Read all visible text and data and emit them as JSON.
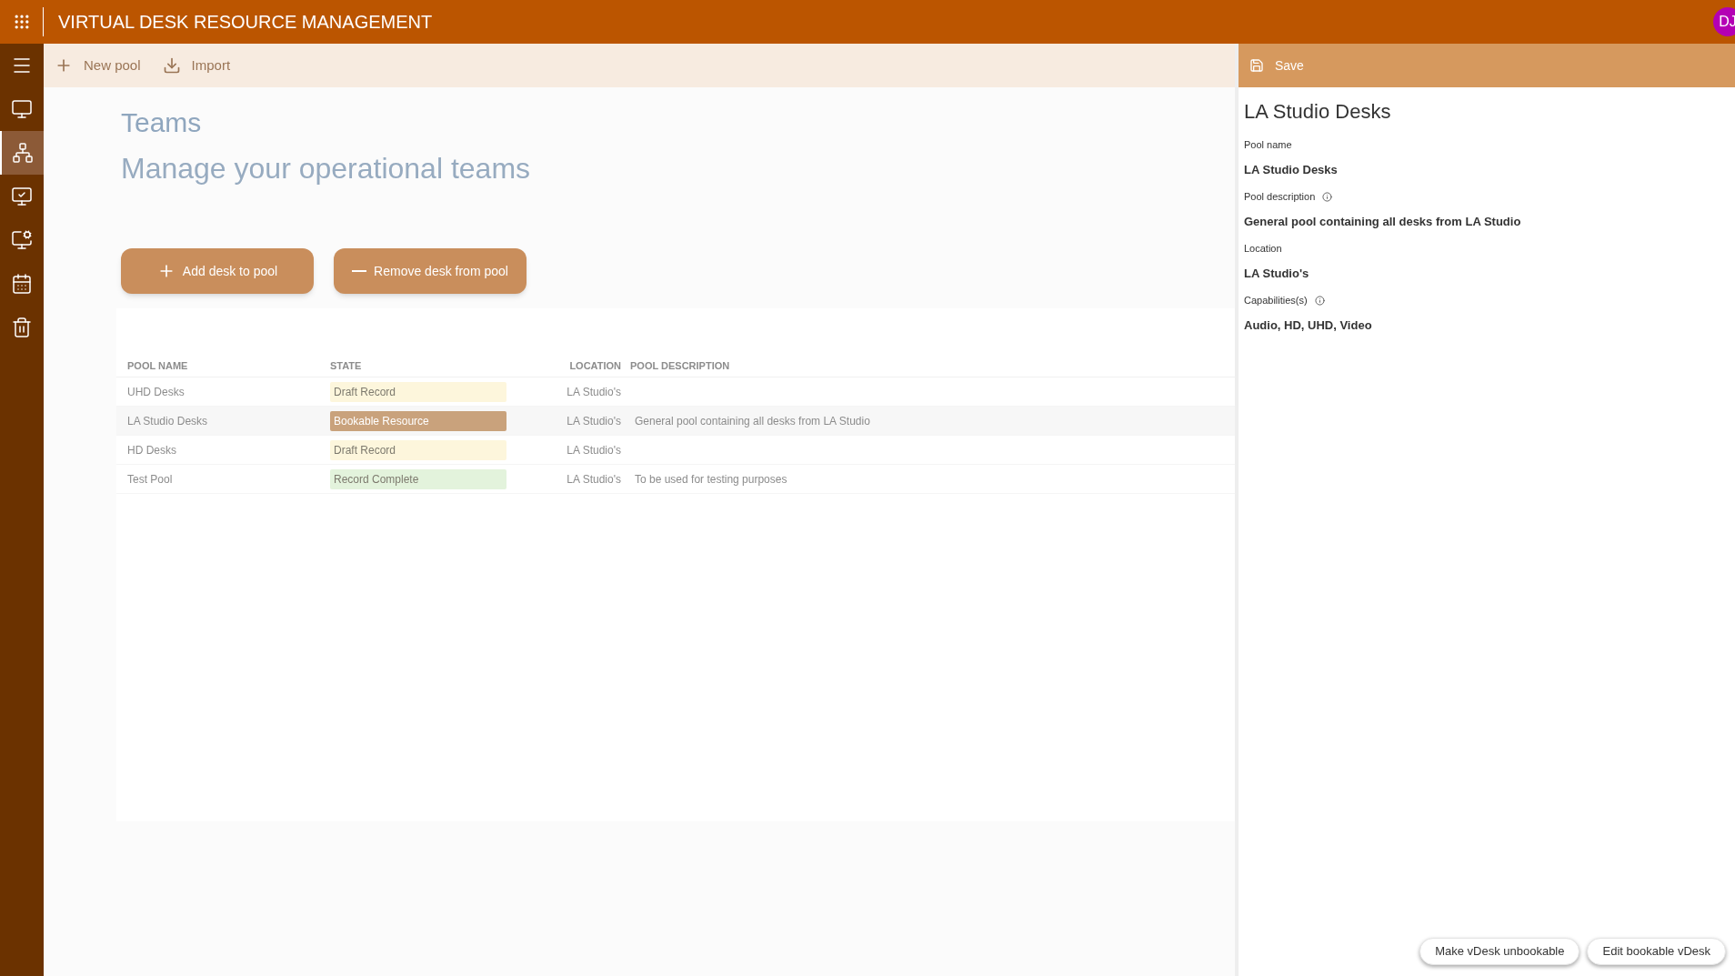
{
  "header": {
    "title": "VIRTUAL DESK RESOURCE MANAGEMENT",
    "avatar": "DJ"
  },
  "nav": [
    {
      "kind": "menu",
      "selected": false
    },
    {
      "kind": "desktop",
      "selected": false
    },
    {
      "kind": "hierarchy",
      "selected": true
    },
    {
      "kind": "desktop-check",
      "selected": false
    },
    {
      "kind": "desktop-gear",
      "selected": false
    },
    {
      "kind": "calendar",
      "selected": false
    },
    {
      "kind": "trash",
      "selected": false
    }
  ],
  "command_bar": [
    {
      "kind": "add",
      "label": "New pool"
    },
    {
      "kind": "download",
      "label": "Import"
    }
  ],
  "page": {
    "title": "Teams",
    "subtitle": "Manage your operational teams"
  },
  "actions": [
    {
      "kind": "add",
      "label": "Add desk to pool"
    },
    {
      "kind": "remove",
      "label": "Remove desk from pool"
    }
  ],
  "table": {
    "columns": [
      "POOL NAME",
      "STATE",
      "LOCATION",
      "POOL DESCRIPTION"
    ],
    "rows": [
      {
        "name": "UHD Desks",
        "state": "Draft Record",
        "color": "#fdf6dc",
        "location": "LA Studio's",
        "description": "",
        "selected": false
      },
      {
        "name": "LA Studio Desks",
        "state": "Bookable Resource",
        "color": "#c9a27c",
        "location": "LA Studio's",
        "description": "General pool containing all desks from LA Studio",
        "selected": true
      },
      {
        "name": "HD Desks",
        "state": "Draft Record",
        "color": "#fdf6dc",
        "location": "LA Studio's",
        "description": "",
        "selected": false
      },
      {
        "name": "Test Pool",
        "state": "Record Complete",
        "color": "#e3f3dc",
        "location": "LA Studio's",
        "description": "To be used for testing purposes",
        "selected": false
      }
    ]
  },
  "panel": {
    "save": "Save",
    "title": "LA Studio Desks",
    "fields": [
      {
        "label": "Pool name",
        "value": "LA Studio Desks",
        "info": false
      },
      {
        "label": "Pool description",
        "value": "General pool containing all desks from LA Studio",
        "info": true
      },
      {
        "label": "Location",
        "value": "LA Studio's",
        "info": false
      },
      {
        "label": "Capabilities(s)",
        "value": "Audio, HD, UHD, Video",
        "info": true
      }
    ],
    "buttons": [
      "Make vDesk unbookable",
      "Edit bookable vDesk"
    ]
  }
}
